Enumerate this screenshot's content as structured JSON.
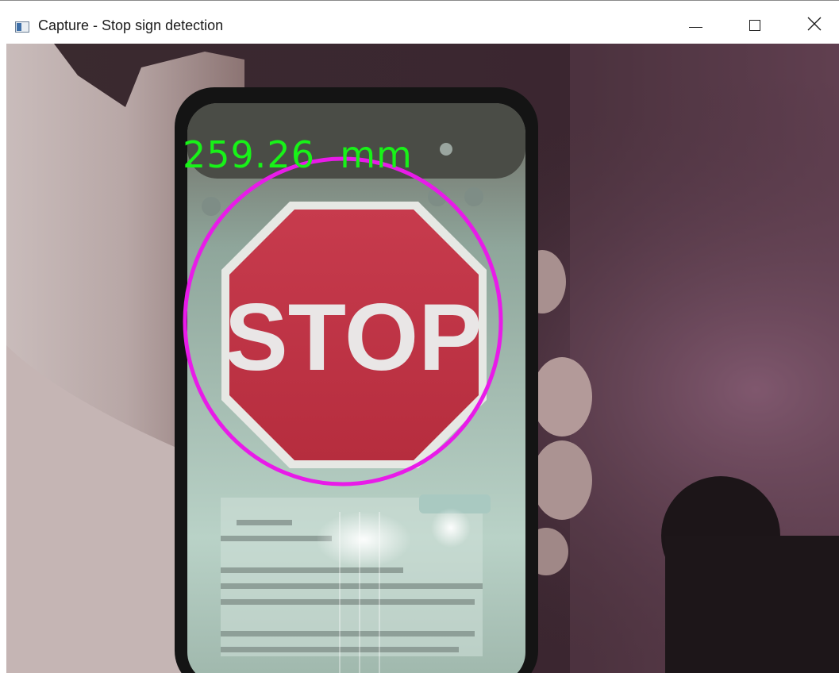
{
  "window": {
    "title": "Capture - Stop sign detection",
    "controls": {
      "minimize_icon": "minimize-icon",
      "maximize_icon": "maximize-icon",
      "close_icon": "close-icon"
    }
  },
  "capture": {
    "distance_label": "259.26  mm",
    "sign_text": "STOP",
    "overlay_colors": {
      "detection_circle": "#e81be8",
      "distance_text": "#18f218"
    }
  }
}
